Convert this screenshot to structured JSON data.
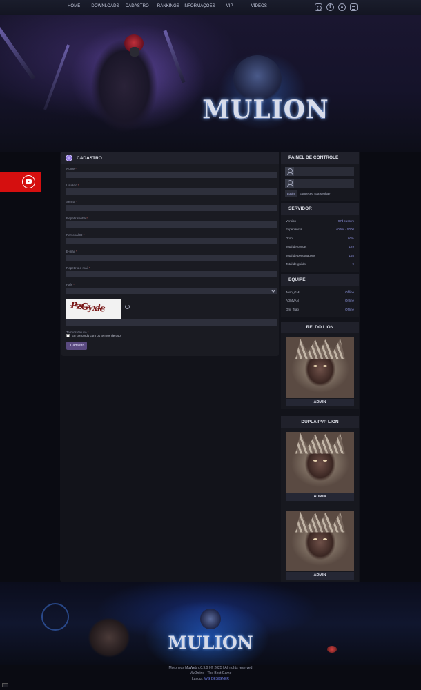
{
  "nav": {
    "items": [
      "HOME",
      "DOWNLOADS",
      "CADASTRO",
      "RANKINGS",
      "INFORMAÇÕES",
      "VIP",
      "VÍDEOS"
    ]
  },
  "social": {
    "icons": [
      "instagram-icon",
      "facebook-icon",
      "whatsapp-icon",
      "discord-icon"
    ]
  },
  "hero": {
    "logo": "MULION"
  },
  "cadastro": {
    "title": "CADASTRO",
    "fields": {
      "nome": "Nome",
      "usuario": "Usuário",
      "senha": "Senha",
      "repetir_senha": "Repetir senha",
      "personal_id": "Personal ID",
      "email": "E-mail",
      "repetir_email": "Repetir o e-mail",
      "pais": "País"
    },
    "required_mark": "*",
    "captcha_text": "PzGyxic",
    "terms_label": "Termos de uso",
    "terms_check": "Eu concordo com os termos de uso",
    "submit": "Cadastro"
  },
  "painel": {
    "title": "PAINEL DE CONTROLE",
    "login_button": "Login",
    "forgot": "Esqueceu sua senha?"
  },
  "servidor": {
    "title": "SERVIDOR",
    "rows": [
      {
        "k": "Version",
        "v": "97d custom"
      },
      {
        "k": "Experiência",
        "v": "4000x - 5000"
      },
      {
        "k": "Drop",
        "v": "60%"
      },
      {
        "k": "Total de contas",
        "v": "129"
      },
      {
        "k": "Total de personagens",
        "v": "155"
      },
      {
        "k": "Total de guilds",
        "v": "9"
      }
    ]
  },
  "equipe": {
    "title": "EQUIPE",
    "rows": [
      {
        "k": "Joon_GM",
        "v": "Offline"
      },
      {
        "k": "ADMVAN",
        "v": "Online"
      },
      {
        "k": "Gm_Trap",
        "v": "Offline"
      }
    ]
  },
  "rei": {
    "title": "REI DO LION",
    "name": "ADMIN"
  },
  "dupla": {
    "title": "DUPLA PVP LION",
    "names": [
      "ADMIN",
      "ADMIN"
    ]
  },
  "footer": {
    "logo": "MULION",
    "line1": "Morpheus MuWeb v.0.9.0 | © 2025 | All rights reserved",
    "line2": "MuOnline - The Best Game",
    "line3_prefix": "Layout:",
    "line3_designer": "WG DESIGNER"
  },
  "colors": {
    "accent": "#5a4a80",
    "youtube": "#d50f0f",
    "value": "#8a8ed8"
  }
}
